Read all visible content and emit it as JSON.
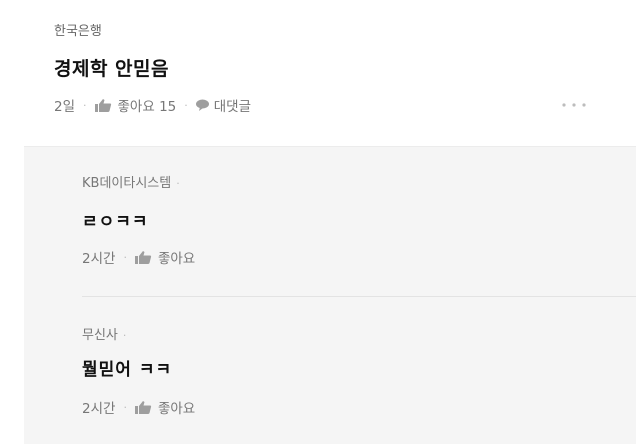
{
  "post": {
    "author": "한국은행",
    "title": "경제학 안믿음",
    "age": "2일",
    "like_label": "좋아요 15",
    "reply_label": "대댓글",
    "more_icon": "more-dots-icon"
  },
  "replies": [
    {
      "author": "KB데이타시스템",
      "text": "ㄹㅇㅋㅋ",
      "age": "2시간",
      "like_label": "좋아요"
    },
    {
      "author": "무신사",
      "text": "뭘믿어 ㅋㅋ",
      "age": "2시간",
      "like_label": "좋아요"
    }
  ],
  "colors": {
    "background": "#ffffff",
    "reply_background": "#f5f5f5",
    "icon_gray": "#9e9e9e"
  }
}
